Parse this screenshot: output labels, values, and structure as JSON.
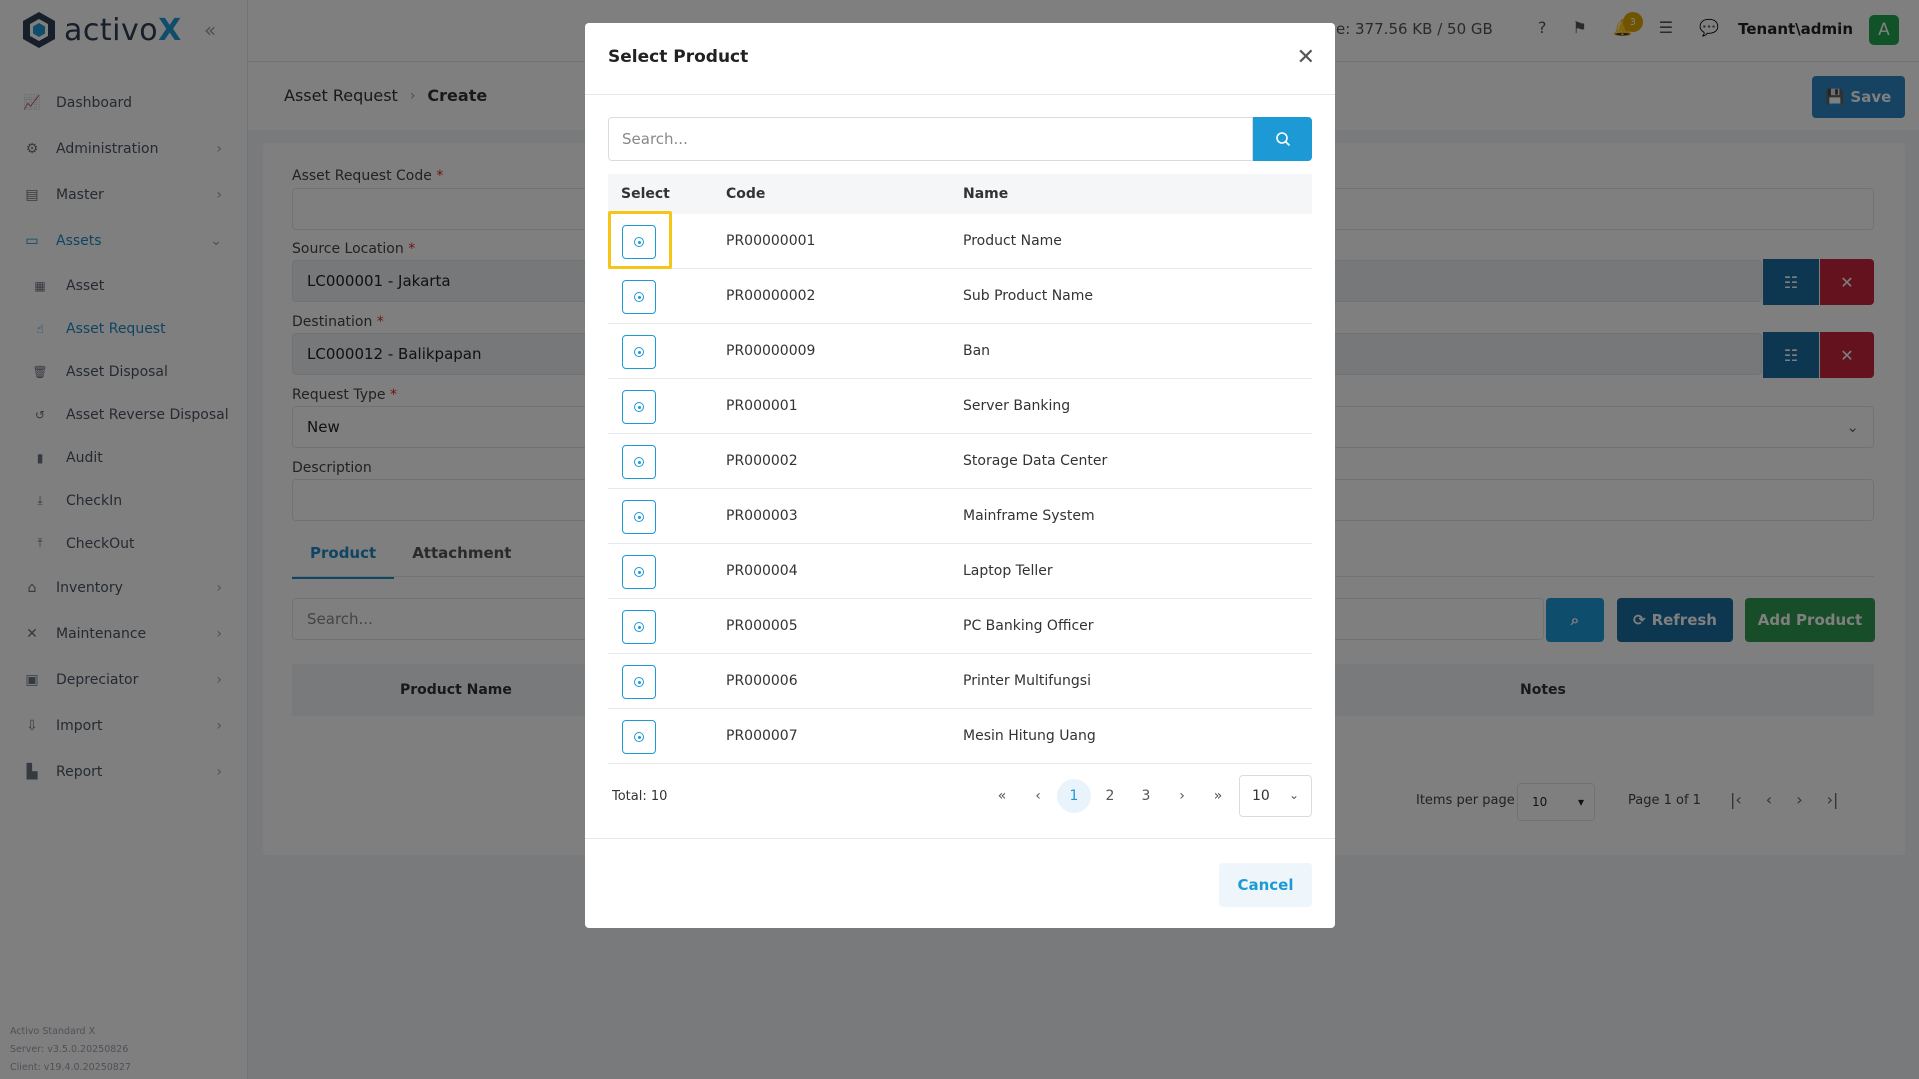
{
  "app": {
    "logo_text": "activo",
    "logo_x": "X",
    "collapse_icon": "«"
  },
  "sidebar": {
    "items": [
      {
        "label": "Dashboard",
        "icon": "chart-icon"
      },
      {
        "label": "Administration",
        "icon": "gears-icon"
      },
      {
        "label": "Master",
        "icon": "database-icon"
      },
      {
        "label": "Assets",
        "icon": "laptop-icon"
      },
      {
        "label": "Inventory",
        "icon": "warehouse-icon"
      },
      {
        "label": "Maintenance",
        "icon": "tools-icon"
      },
      {
        "label": "Depreciator",
        "icon": "wallet-icon"
      },
      {
        "label": "Import",
        "icon": "import-icon"
      },
      {
        "label": "Report",
        "icon": "report-icon"
      }
    ],
    "sub_items": [
      {
        "label": "Asset"
      },
      {
        "label": "Asset Request"
      },
      {
        "label": "Asset Disposal"
      },
      {
        "label": "Asset Reverse Disposal"
      },
      {
        "label": "Audit"
      },
      {
        "label": "CheckIn"
      },
      {
        "label": "CheckOut"
      }
    ],
    "version": {
      "product": "Activo Standard X",
      "server": "Server: v3.5.0.20250826",
      "client": "Client: v19.4.0.20250827"
    }
  },
  "topbar": {
    "storage": "e: 377.56 KB / 50 GB",
    "notification_count": "3",
    "user": "Tenant\\admin",
    "avatar_letter": "A"
  },
  "page": {
    "breadcrumb_parent": "Asset Request",
    "breadcrumb_current": "Create",
    "save_label": "Save"
  },
  "form": {
    "code_label": "Asset Request Code",
    "source_label": "Source Location",
    "source_value": "LC000001 - Jakarta",
    "destination_label": "Destination",
    "destination_value": "LC000012 - Balikpapan",
    "request_type_label": "Request Type",
    "request_type_value": "New",
    "description_label": "Description",
    "required_mark": "*"
  },
  "tabs": [
    {
      "label": "Product"
    },
    {
      "label": "Attachment"
    }
  ],
  "product_table": {
    "search_placeholder": "Search...",
    "refresh_label": "Refresh",
    "add_label": "Add Product",
    "col_product_name": "Product Name",
    "col_notes": "Notes",
    "items_per_page_label": "Items per page",
    "items_per_page_value": "10",
    "page_info": "Page 1 of 1"
  },
  "modal": {
    "title": "Select Product",
    "search_placeholder": "Search...",
    "columns": {
      "select": "Select",
      "code": "Code",
      "name": "Name"
    },
    "rows": [
      {
        "code": "PR00000001",
        "name": "Product Name"
      },
      {
        "code": "PR00000002",
        "name": "Sub Product Name"
      },
      {
        "code": "PR00000009",
        "name": "Ban"
      },
      {
        "code": "PR000001",
        "name": "Server Banking"
      },
      {
        "code": "PR000002",
        "name": "Storage Data Center"
      },
      {
        "code": "PR000003",
        "name": "Mainframe System"
      },
      {
        "code": "PR000004",
        "name": "Laptop Teller"
      },
      {
        "code": "PR000005",
        "name": "PC Banking Officer"
      },
      {
        "code": "PR000006",
        "name": "Printer Multifungsi"
      },
      {
        "code": "PR000007",
        "name": "Mesin Hitung Uang"
      }
    ],
    "total": "Total: 10",
    "pages": [
      "1",
      "2",
      "3"
    ],
    "page_size": "10",
    "cancel_label": "Cancel"
  },
  "colors": {
    "primary": "#1d9ad6",
    "danger": "#c9253d",
    "success": "#22a652",
    "highlight": "#f5c518"
  }
}
